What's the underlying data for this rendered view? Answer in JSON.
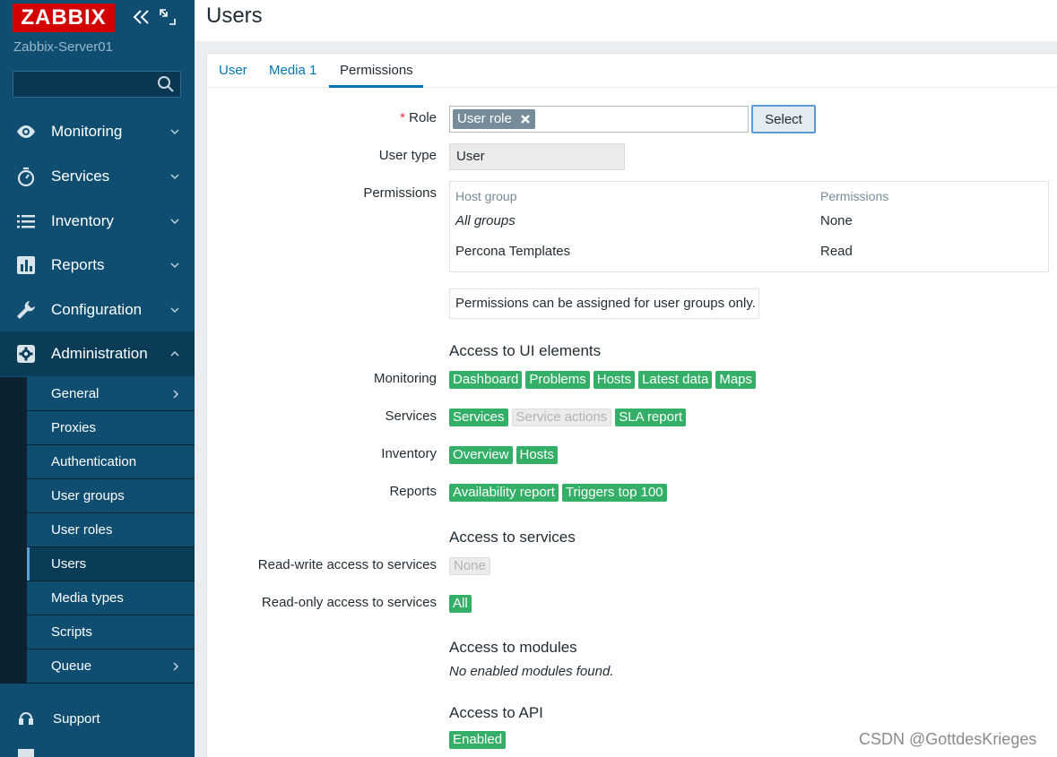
{
  "sidebar": {
    "logo": "ZABBIX",
    "server_name": "Zabbix-Server01",
    "search_placeholder": "",
    "menu": [
      {
        "label": "Monitoring",
        "icon": "eye-icon"
      },
      {
        "label": "Services",
        "icon": "stopwatch-icon"
      },
      {
        "label": "Inventory",
        "icon": "list-icon"
      },
      {
        "label": "Reports",
        "icon": "bar-chart-icon"
      },
      {
        "label": "Configuration",
        "icon": "wrench-icon"
      },
      {
        "label": "Administration",
        "icon": "gear-icon",
        "expanded": true
      }
    ],
    "submenu": [
      {
        "label": "General",
        "has_arrow": true
      },
      {
        "label": "Proxies"
      },
      {
        "label": "Authentication"
      },
      {
        "label": "User groups"
      },
      {
        "label": "User roles"
      },
      {
        "label": "Users",
        "selected": true
      },
      {
        "label": "Media types"
      },
      {
        "label": "Scripts"
      },
      {
        "label": "Queue",
        "has_arrow": true
      }
    ],
    "support_label": "Support"
  },
  "header": {
    "title": "Users"
  },
  "tabs": [
    {
      "label": "User"
    },
    {
      "label": "Media",
      "count": "1"
    },
    {
      "label": "Permissions",
      "active": true
    }
  ],
  "form": {
    "role_label": "Role",
    "role_required_mark": "*",
    "role_value": "User role",
    "select_label": "Select",
    "user_type_label": "User type",
    "user_type_value": "User",
    "permissions_label": "Permissions",
    "permissions_table": {
      "headers": [
        "Host group",
        "Permissions"
      ],
      "rows": [
        {
          "group": "All groups",
          "permission": "None"
        },
        {
          "group": "Percona Templates",
          "permission": "Read"
        }
      ]
    },
    "permissions_note": "Permissions can be assigned for user groups only."
  },
  "ui_access": {
    "title": "Access to UI elements",
    "groups": [
      {
        "label": "Monitoring",
        "items": [
          {
            "text": "Dashboard",
            "enabled": true
          },
          {
            "text": "Problems",
            "enabled": true
          },
          {
            "text": "Hosts",
            "enabled": true
          },
          {
            "text": "Latest data",
            "enabled": true
          },
          {
            "text": "Maps",
            "enabled": true
          }
        ]
      },
      {
        "label": "Services",
        "items": [
          {
            "text": "Services",
            "enabled": true
          },
          {
            "text": "Service actions",
            "enabled": false
          },
          {
            "text": "SLA report",
            "enabled": true
          }
        ]
      },
      {
        "label": "Inventory",
        "items": [
          {
            "text": "Overview",
            "enabled": true
          },
          {
            "text": "Hosts",
            "enabled": true
          }
        ]
      },
      {
        "label": "Reports",
        "items": [
          {
            "text": "Availability report",
            "enabled": true
          },
          {
            "text": "Triggers top 100",
            "enabled": true
          }
        ]
      }
    ]
  },
  "services_access": {
    "title": "Access to services",
    "read_write_label": "Read-write access to services",
    "read_write_value": "None",
    "read_only_label": "Read-only access to services",
    "read_only_value": "All"
  },
  "modules_access": {
    "title": "Access to modules",
    "note": "No enabled modules found."
  },
  "api_access": {
    "title": "Access to API",
    "value": "Enabled"
  },
  "watermark": "CSDN @GottdesKrieges",
  "colors": {
    "sidebar_bg": "#0f4e71",
    "logo_red": "#d40000",
    "badge_green": "#34af67",
    "link_blue": "#0275b8"
  }
}
